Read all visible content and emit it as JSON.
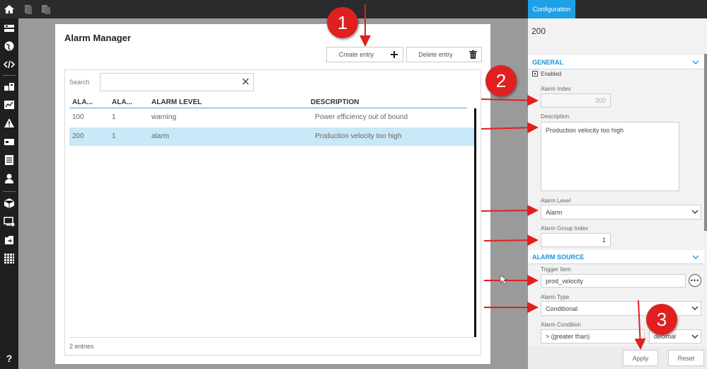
{
  "config_tab": "Configuration",
  "page": {
    "title": "Alarm Manager",
    "create_label": "Create entry",
    "delete_label": "Delete entry",
    "search_label": "Search",
    "search_value": "",
    "columns": [
      "ALA...",
      "ALA...",
      "ALARM LEVEL",
      "DESCRIPTION"
    ],
    "rows": [
      {
        "index": "100",
        "group": "1",
        "level": "warning",
        "description": "Power efficiency out of bound",
        "selected": false
      },
      {
        "index": "200",
        "group": "1",
        "level": "alarm",
        "description": "Production velocity too high",
        "selected": true
      }
    ],
    "entries_text": "2 entries"
  },
  "panel": {
    "id": "200",
    "general_title": "GENERAL",
    "enabled_label": "Enabled",
    "alarm_index_label": "Alarm Index",
    "alarm_index_value": "200",
    "description_label": "Description",
    "description_value": "Production velocity too high",
    "alarm_level_label": "Alarm Level",
    "alarm_level_value": "Alarm",
    "alarm_group_label": "Alarm Group Index",
    "alarm_group_value": "1",
    "source_title": "ALARM SOURCE",
    "trigger_label": "Trigger Item",
    "trigger_value": "prod_velocity",
    "type_label": "Alarm Type",
    "type_value": "Conditional",
    "condition_label": "Alarm Condition",
    "condition_value": "> (greater than)",
    "condition_format": "decimal",
    "apply_label": "Apply",
    "reset_label": "Reset"
  },
  "annotations": {
    "badge1": "1",
    "badge2": "2",
    "badge3": "3"
  },
  "colors": {
    "accent": "#1ea0e6",
    "selection": "#c9e8f8",
    "annotation": "#e02020"
  }
}
